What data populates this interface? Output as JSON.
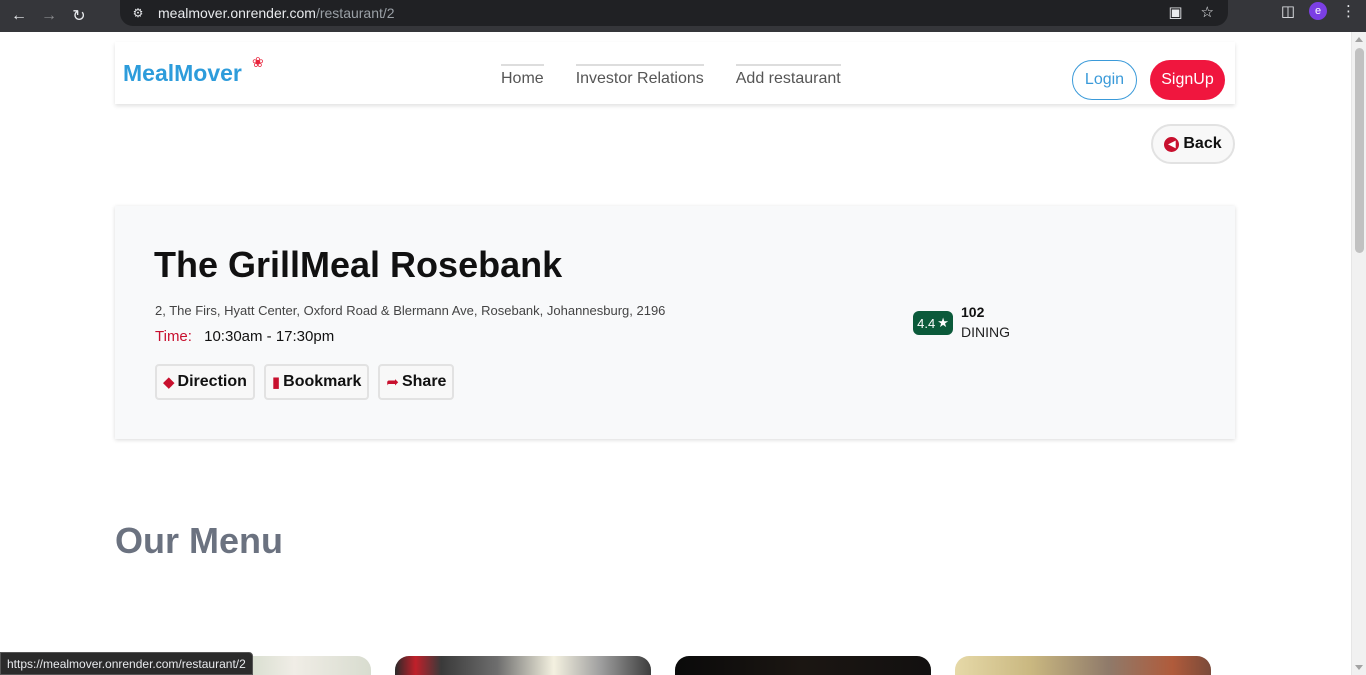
{
  "browser": {
    "url_host": "mealmover.onrender.com",
    "url_path": "/restaurant/2",
    "profile_initial": "e",
    "status_url": "https://mealmover.onrender.com/restaurant/2"
  },
  "navbar": {
    "logo": "MealMover",
    "links": [
      "Home",
      "Investor Relations",
      "Add restaurant"
    ],
    "login_label": "Login",
    "signup_label": "SignUp"
  },
  "back_label": "Back",
  "restaurant": {
    "name": "The GrillMeal Rosebank",
    "address": "2, The Firs, Hyatt Center, Oxford Road & Blermann Ave, Rosebank, Johannesburg, 2196",
    "time_label": "Time:",
    "time_value": "10:30am - 17:30pm",
    "actions": [
      "Direction",
      "Bookmark",
      "Share"
    ],
    "rating": "4.4",
    "rating_count": "102",
    "rating_type": "DINING"
  },
  "menu_heading": "Our Menu",
  "colors": {
    "brand_blue": "#2d9cdb",
    "brand_red": "#f0163e",
    "accent_red": "#c8102e",
    "rating_green": "#0b5a3a"
  },
  "icons": {
    "back": "arrow-circle-left-icon",
    "direction": "direction-sign-icon",
    "bookmark": "bookmark-icon",
    "share": "share-arrow-icon",
    "rating_star": "star-icon"
  }
}
